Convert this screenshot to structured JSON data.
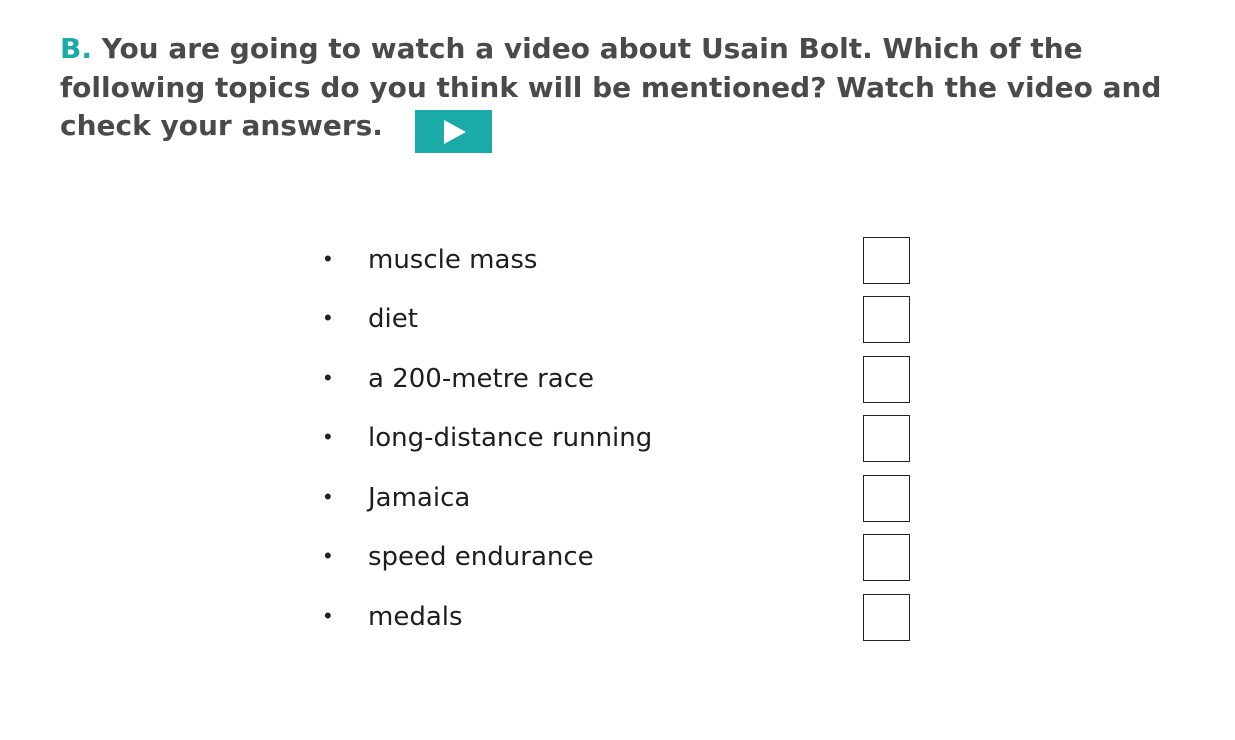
{
  "exercise": {
    "letter": "B",
    "letter_dot": ".",
    "instruction": " You are going to watch a video about Usain Bolt. Which of the following topics do you think will be mentioned? Watch the video and check your answers.",
    "play_icon": "play-icon",
    "accent_color": "#1aaaa8",
    "text_color": "#4a4a4a"
  },
  "topics": [
    {
      "label": "muscle mass",
      "checked": false
    },
    {
      "label": "diet",
      "checked": false
    },
    {
      "label": "a 200-metre race",
      "checked": false
    },
    {
      "label": "long-distance running",
      "checked": false
    },
    {
      "label": "Jamaica",
      "checked": false
    },
    {
      "label": "speed endurance",
      "checked": false
    },
    {
      "label": "medals",
      "checked": false
    }
  ],
  "bullet_glyph": "•"
}
